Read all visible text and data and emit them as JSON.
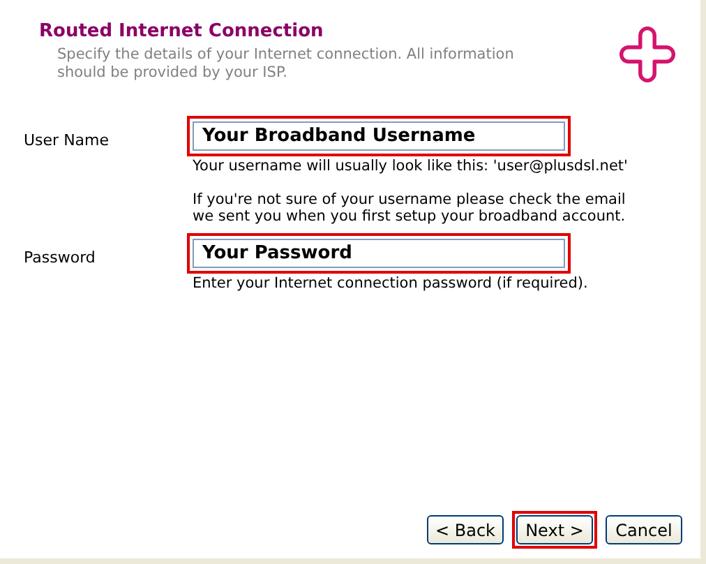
{
  "header": {
    "title": "Routed Internet Connection",
    "subtitle": "Specify the details of your Internet connection. All information should be provided by your ISP."
  },
  "fields": [
    {
      "label": "User Name",
      "value": "Your Broadband Username",
      "highlighted": true,
      "help": [
        "Your username will usually look like this: 'user@plusdsl.net'",
        "If you're not sure of your username please check the email we sent you when you first setup your broadband account."
      ]
    },
    {
      "label": "Password",
      "value": "Your Password",
      "highlighted": true,
      "help": [
        "Enter your Internet connection password (if required)."
      ]
    }
  ],
  "buttons": [
    {
      "label": "< Back",
      "highlighted": false
    },
    {
      "label": "Next >",
      "highlighted": true
    },
    {
      "label": "Cancel",
      "highlighted": false
    }
  ]
}
